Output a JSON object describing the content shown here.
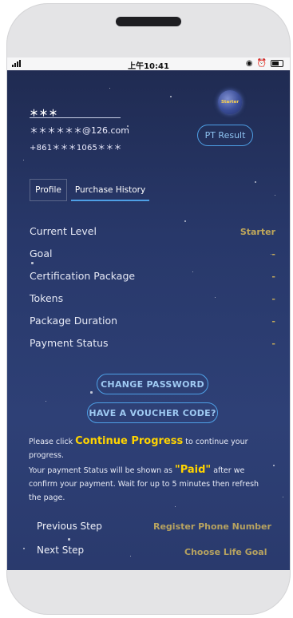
{
  "status_bar": {
    "time": "上午10:41"
  },
  "user": {
    "name": "＊＊＊",
    "email": "＊＊＊＊＊＊@126.com",
    "phone": "+861＊＊＊1065＊＊＊"
  },
  "badge": {
    "level": "Starter"
  },
  "buttons": {
    "pt_result": "PT Result",
    "change_password": "CHANGE PASSWORD",
    "voucher": "HAVE A VOUCHER CODE?"
  },
  "tabs": [
    {
      "label": "Profile"
    },
    {
      "label": "Purchase History"
    }
  ],
  "details": {
    "rows": [
      {
        "label": "Current Level",
        "value": "Starter"
      },
      {
        "label": "Goal",
        "value": "-"
      },
      {
        "label": "Certification Package",
        "value": "-"
      },
      {
        "label": "Tokens",
        "value": "-"
      },
      {
        "label": "Package Duration",
        "value": "-"
      },
      {
        "label": "Payment Status",
        "value": "-"
      }
    ]
  },
  "info": {
    "line1_pre": "Please click ",
    "line1_hl": "Continue Progress",
    "line1_post": " to continue your progress.",
    "line2_pre": "Your payment Status will be shown as ",
    "line2_hl": "\"Paid\"",
    "line2_post": " after we confirm your payment. Wait for up to 5 minutes then refresh the page."
  },
  "steps": {
    "previous_label": "Previous Step",
    "previous_link": "Register Phone Number",
    "next_label": "Next Step",
    "next_link": "Choose Life Goal"
  },
  "colors": {
    "accent_blue": "#4ea0e6",
    "gold": "#c1a85a",
    "highlight_yellow": "#ffd400",
    "screen_bg": "#28386a"
  }
}
